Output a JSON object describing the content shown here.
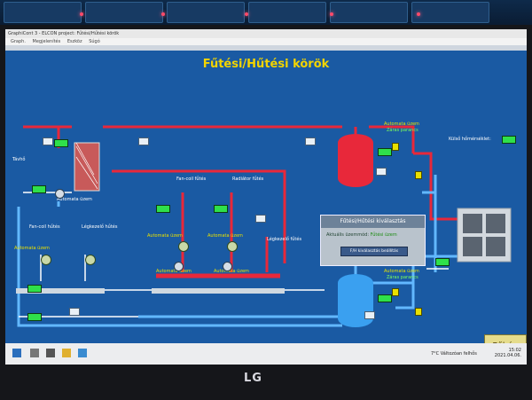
{
  "window": {
    "title": "GraphiCont 3 - ELCON project: Fűtési/Hűtési körök",
    "menu": [
      "Graph.",
      "Megjelenítés",
      "Eszköz",
      "Súgó"
    ]
  },
  "hmi": {
    "title": "Fűtési/Hűtési körök",
    "outdoor_temp_label": "Külső hőmérséklet:",
    "labels": {
      "tavho": "Távhő",
      "auto1": "Automata üzem",
      "fancoil_heat": "Fan-coil fűtés",
      "radiator_heat": "Radiátor fűtés",
      "fancoil_cool": "Fan-coil hűtés",
      "airhandler_cool": "Légkezelő hűtés",
      "airhandler_heat": "Légkezelő fűtés",
      "auto_top": "Automata üzem",
      "closing_top": "Záras parancs",
      "auto_bottom": "Automata üzem",
      "closing_bottom": "Záras parancs",
      "auto_left": "Automata üzem",
      "auto_fc": "Automata üzem",
      "auto_rad": "Automata üzem",
      "auto_fc_low": "Automata üzem",
      "auto_rad_low": "Automata üzem"
    },
    "selector": {
      "header": "Fűtési/Hűtési kiválasztás",
      "mode_label": "Aktuális üzemmód:",
      "mode_value": "Fűtési üzem",
      "button": "F/H kiválasztás beállítás"
    },
    "home_button": "Főkép"
  },
  "taskbar": {
    "weather": "7°C Változóan felhős",
    "time": "15:02",
    "date": "2021.04.06."
  },
  "monitor": {
    "brand": "LG"
  },
  "colors": {
    "hot_pipe": "#e8283a",
    "cold_pipe": "#62b8ff",
    "background": "#1a5aa3",
    "title": "#f2d400"
  }
}
